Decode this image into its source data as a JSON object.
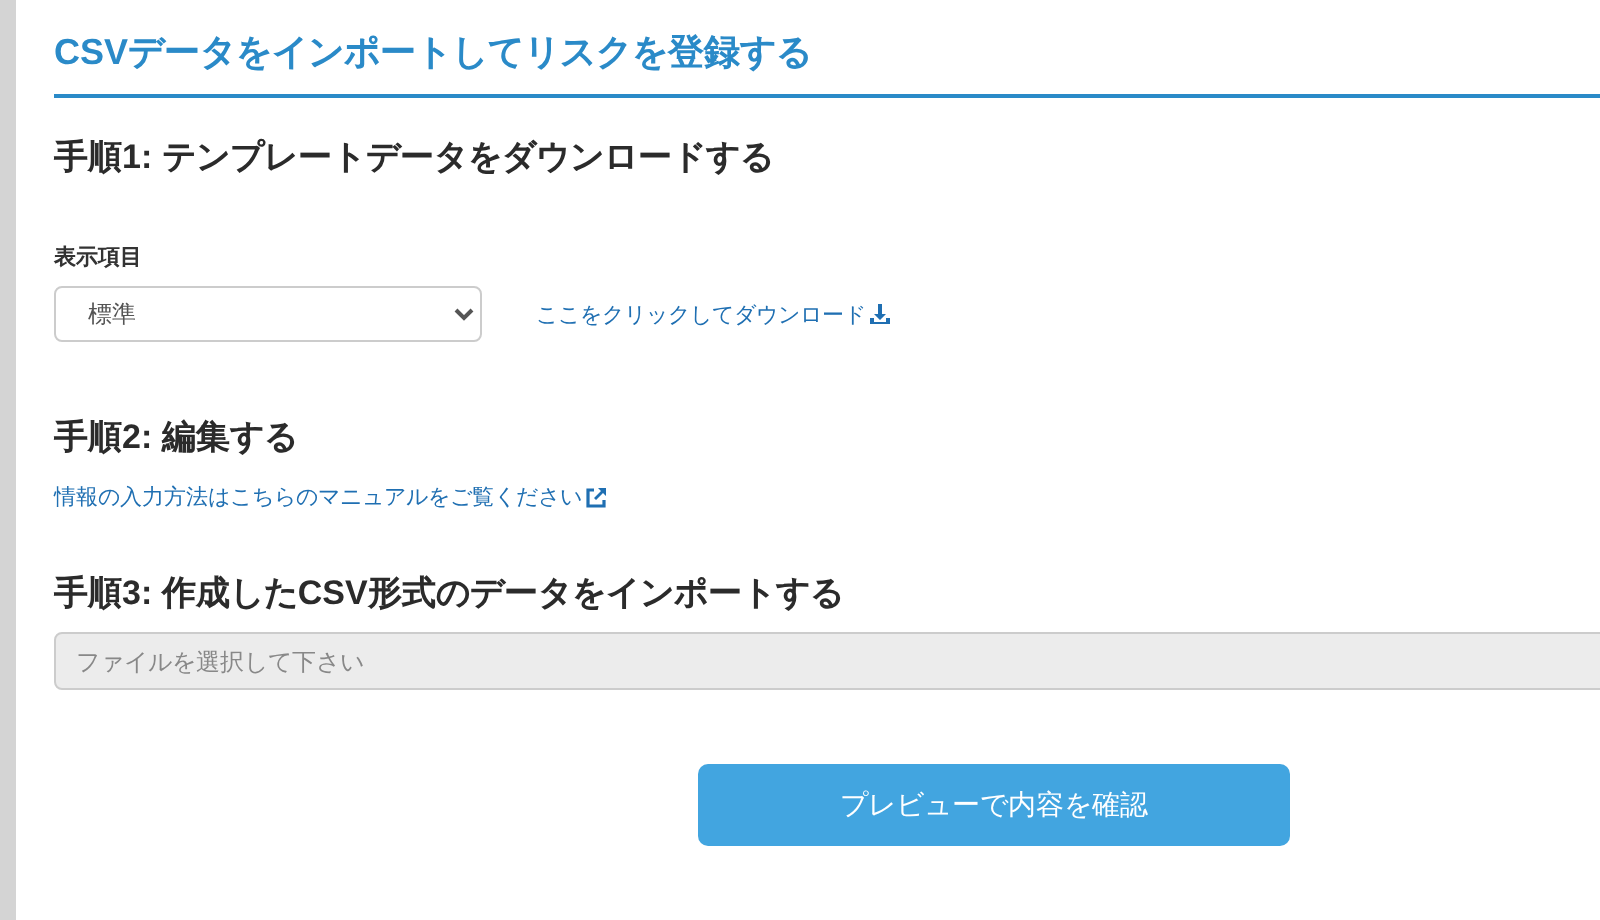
{
  "title": "CSVデータをインポートしてリスクを登録する",
  "step1": {
    "heading": "手順1: テンプレートデータをダウンロードする",
    "field_label": "表示項目",
    "select_value": "標準",
    "download_link": "ここをクリックしてダウンロード"
  },
  "step2": {
    "heading": "手順2: 編集する",
    "manual_link": "情報の入力方法はこちらのマニュアルをご覧ください"
  },
  "step3": {
    "heading": "手順3: 作成したCSV形式のデータをインポートする",
    "file_placeholder": "ファイルを選択して下さい"
  },
  "preview_button": "プレビューで内容を確認"
}
